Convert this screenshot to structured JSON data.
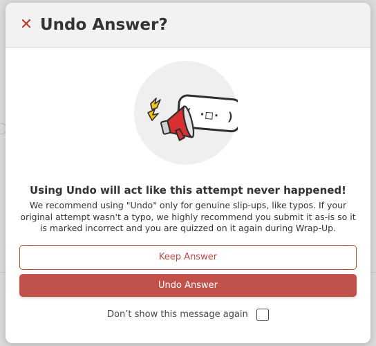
{
  "dialog": {
    "title": "Undo Answer?",
    "close_icon": "close-icon",
    "illustration_icon": "megaphone-speech-bubble-icon",
    "bubble_text": "( ·□· )",
    "headline": "Using Undo will act like this attempt never happened!",
    "body": "We recommend using \"Undo\" only for genuine slip-ups, like typos. If your original attempt wasn't a typo, we highly recommend you submit it as-is so it is marked incorrect and you are quizzed on it again during Wrap-Up.",
    "keep_label": "Keep Answer",
    "undo_label": "Undo Answer",
    "dont_show_label": "Don’t show this message again",
    "dont_show_checked": false
  },
  "colors": {
    "accent": "#c0514b",
    "header_bg": "#f2f2f2",
    "text": "#333333"
  }
}
